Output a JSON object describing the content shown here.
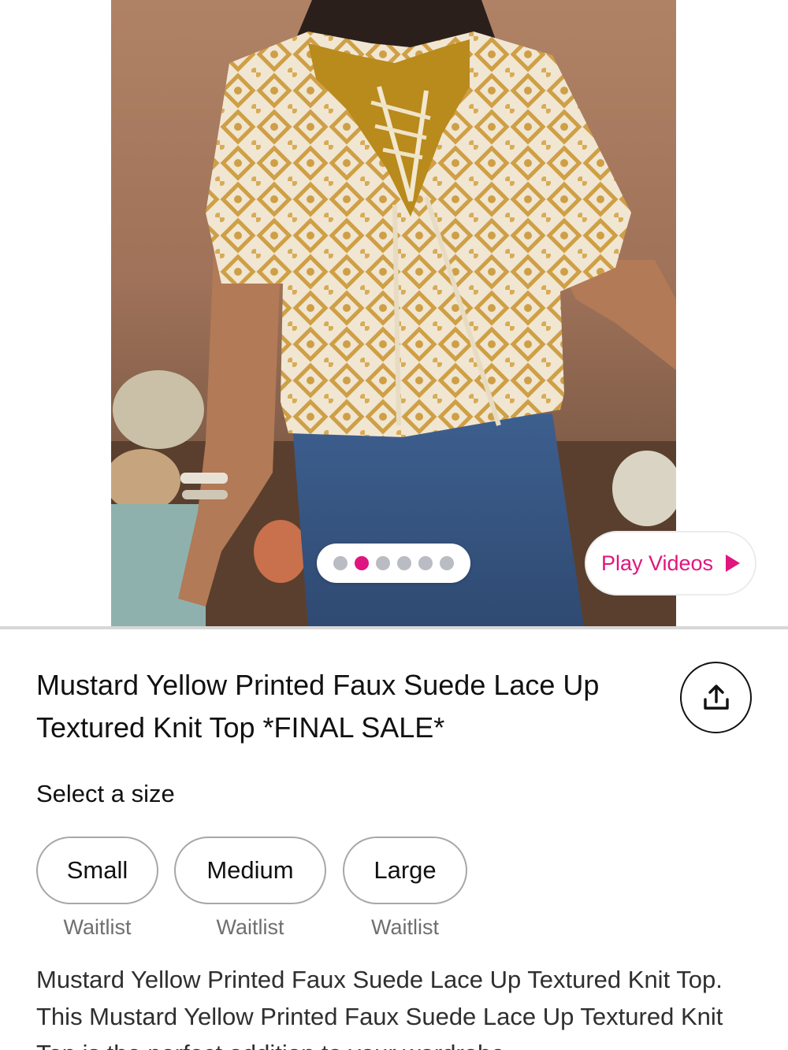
{
  "gallery": {
    "image_count": 6,
    "active_index": 1,
    "play_videos_label": "Play Videos",
    "accent_color": "#e0157f",
    "play_icon": "play-triangle-icon"
  },
  "product": {
    "title": "Mustard Yellow Printed Faux Suede Lace Up Textured Knit Top *FINAL SALE*",
    "share_icon": "share-upload-icon",
    "select_size_label": "Select a size",
    "sizes": [
      {
        "label": "Small",
        "status": "Waitlist"
      },
      {
        "label": "Medium",
        "status": "Waitlist"
      },
      {
        "label": "Large",
        "status": "Waitlist"
      }
    ],
    "description": "Mustard Yellow Printed Faux Suede Lace Up Textured Knit Top. This Mustard Yellow Printed Faux Suede Lace Up Textured Knit Top is the perfect addition to your wardrobe"
  }
}
